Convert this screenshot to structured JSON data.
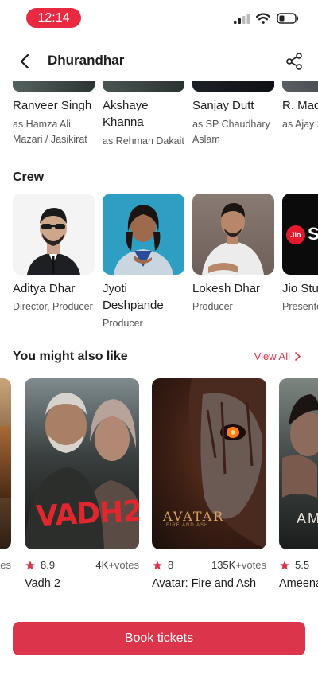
{
  "status": {
    "time": "12:14"
  },
  "header": {
    "title": "Dhurandhar"
  },
  "cast": [
    {
      "name": "Ranveer Singh",
      "role": "as Hamza Ali Mazari / Jasikirat"
    },
    {
      "name": "Akshaye Khanna",
      "role": "as Rehman Dakait"
    },
    {
      "name": "Sanjay Dutt",
      "role": "as SP Chaudhary Aslam"
    },
    {
      "name": "R. Mad",
      "role": "as Ajay S"
    }
  ],
  "crew_section": {
    "title": "Crew",
    "items": [
      {
        "name": "Aditya Dhar",
        "role": "Director, Producer"
      },
      {
        "name": "Jyoti Deshpande",
        "role": "Producer"
      },
      {
        "name": "Lokesh Dhar",
        "role": "Producer"
      },
      {
        "name": "Jio Stu",
        "role": "Presente",
        "logo": "Jio"
      }
    ]
  },
  "recommendations": {
    "title": "You might also like",
    "view_all": "View All",
    "left_partial_votes": "otes",
    "items": [
      {
        "rating": "8.9",
        "votes": "4K+",
        "votes_suffix": "votes",
        "title": "Vadh 2",
        "poster_text": "VADH2"
      },
      {
        "rating": "8",
        "votes": "135K+",
        "votes_suffix": "votes",
        "title": "Avatar: Fire and Ash",
        "poster_text": "AVATAR",
        "poster_subtext": "FIRE AND ASH"
      },
      {
        "rating": "5.5",
        "votes": "",
        "votes_suffix": "",
        "title": "Ameena",
        "poster_text": "AM"
      }
    ]
  },
  "footer": {
    "book_label": "Book tickets"
  },
  "colors": {
    "brand": "#dc354b",
    "status_pill": "#e8293f"
  }
}
